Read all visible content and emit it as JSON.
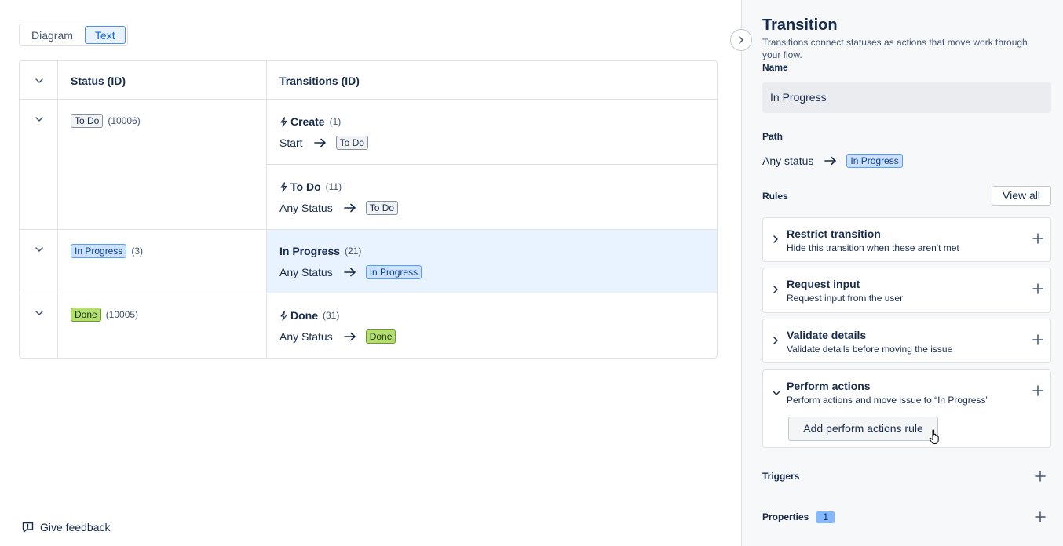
{
  "view_toggle": {
    "diagram": "Diagram",
    "text": "Text"
  },
  "table": {
    "headers": {
      "status": "Status (ID)",
      "transitions": "Transitions (ID)"
    },
    "rows": [
      {
        "status": "To Do",
        "status_id": "(10006)",
        "transitions": [
          {
            "name": "Create",
            "id": "(1)",
            "from": "Start",
            "to": "To Do"
          },
          {
            "name": "To Do",
            "id": "(11)",
            "from": "Any Status",
            "to": "To Do"
          }
        ]
      },
      {
        "status": "In Progress",
        "status_id": "(3)",
        "transitions": [
          {
            "name": "In Progress",
            "id": "(21)",
            "from": "Any Status",
            "to": "In Progress"
          }
        ]
      },
      {
        "status": "Done",
        "status_id": "(10005)",
        "transitions": [
          {
            "name": "Done",
            "id": "(31)",
            "from": "Any Status",
            "to": "Done"
          }
        ]
      }
    ]
  },
  "feedback": {
    "label": "Give feedback"
  },
  "panel": {
    "title": "Transition",
    "description": "Transitions connect statuses as actions that move work through your flow.",
    "name_label": "Name",
    "name_value": "In Progress",
    "path_label": "Path",
    "path_from": "Any status",
    "path_to": "In Progress",
    "rules_label": "Rules",
    "view_all": "View all",
    "rules": [
      {
        "title": "Restrict transition",
        "description": "Hide this transition when these aren't met"
      },
      {
        "title": "Request input",
        "description": "Request input from the user"
      },
      {
        "title": "Validate details",
        "description": "Validate details before moving the issue"
      },
      {
        "title": "Perform actions",
        "description": "Perform actions and move issue to “In Progress”",
        "button": "Add perform actions rule"
      }
    ],
    "triggers_label": "Triggers",
    "properties_label": "Properties",
    "properties_count": "1"
  },
  "colors": {
    "accent": "#0c66e4",
    "selected_row": "#e9f2ff",
    "in_progress": "#cce0ff",
    "done": "#b3df72"
  }
}
